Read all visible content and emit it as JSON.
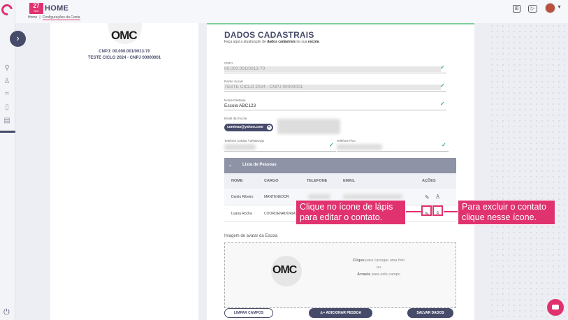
{
  "header": {
    "date_day": "27",
    "date_month": "Nov",
    "title": "HOME",
    "breadcrumb": [
      "Home",
      "Configurações da Conta"
    ]
  },
  "school": {
    "logo_text": "OMC",
    "cnpj_line": "CNPJ: 00.000.001/0013-70",
    "name_line": "TESTE CICLO 2024 - CNPJ 00000001"
  },
  "form": {
    "title": "DADOS CADASTRAIS",
    "subtitle_prefix": "Faça aqui a atualização de ",
    "subtitle_bold1": "dados cadastrais",
    "subtitle_mid": " da sua ",
    "subtitle_bold2": "escola",
    "subtitle_end": ".",
    "cnpj_label": "CNPJ",
    "cnpj_value": "00.000.001/0013-70",
    "razao_label": "Razão Social",
    "razao_value": "TESTE CICLO 2024 - CNPJ 00000001",
    "fantasia_label": "Nome Fantasia",
    "fantasia_value": "Escola ABC123",
    "email_label": "Email da Escola",
    "email_chip": "cominas@yahoo.com",
    "phone_mobile_label": "Telefone Celular / WhatsApp",
    "phone_fixed_label": "Telefone Fixo"
  },
  "persons": {
    "section_title": "Lista de Pessoas",
    "columns": [
      "NOME",
      "CARGO",
      "TELEFONE",
      "EMAIL",
      "AÇÕES"
    ],
    "rows": [
      {
        "nome": "Danilo Ribeiro",
        "cargo": "MANTENEDOR"
      },
      {
        "nome": "Luana Rocha",
        "cargo": "COORDENADOR(A)"
      }
    ]
  },
  "avatar_upload": {
    "label": "Imagem de avatar da Escola",
    "click_bold": "Clique",
    "click_text": " para carregar uma foto",
    "or_text": "ou",
    "drag_bold": "Arraste",
    "drag_text": " para este campo"
  },
  "buttons": {
    "clear": "LIMPAR CAMPOS",
    "add_person": "ADICIONAR PESSOA",
    "save": "SALVAR DADOS"
  },
  "callouts": {
    "edit": "Clique no ícone de lápis para editar o contato.",
    "delete": "Para excluir o contato clique nesse ícone."
  },
  "colors": {
    "brand_pink": "#e0326e",
    "navy": "#474b6a",
    "success": "#3cb371"
  }
}
